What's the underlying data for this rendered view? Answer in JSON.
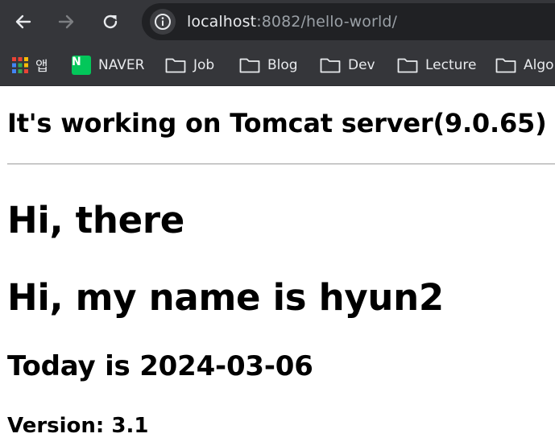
{
  "browser": {
    "url_host": "localhost",
    "url_rest": ":8082/hello-world/",
    "colors": {
      "chrome": "#35363a",
      "omnibox": "#202124",
      "text": "#e8eaed",
      "muted": "#9aa0a6",
      "naver": "#03c75a"
    }
  },
  "bookmarks": {
    "apps_label": "앱",
    "naver_logo_letter": "N",
    "items": [
      {
        "label": "NAVER",
        "icon": "naver-logo-icon"
      },
      {
        "label": "Job",
        "icon": "folder-icon"
      },
      {
        "label": "Blog",
        "icon": "folder-icon"
      },
      {
        "label": "Dev",
        "icon": "folder-icon"
      },
      {
        "label": "Lecture",
        "icon": "folder-icon"
      },
      {
        "label": "Algo",
        "icon": "folder-icon"
      }
    ]
  },
  "page": {
    "header": "It's working on Tomcat server(9.0.65)",
    "greeting": "Hi, there",
    "name_line": "Hi, my name is hyun2",
    "date_line": "Today is 2024-03-06",
    "version_line": "Version: 3.1"
  }
}
